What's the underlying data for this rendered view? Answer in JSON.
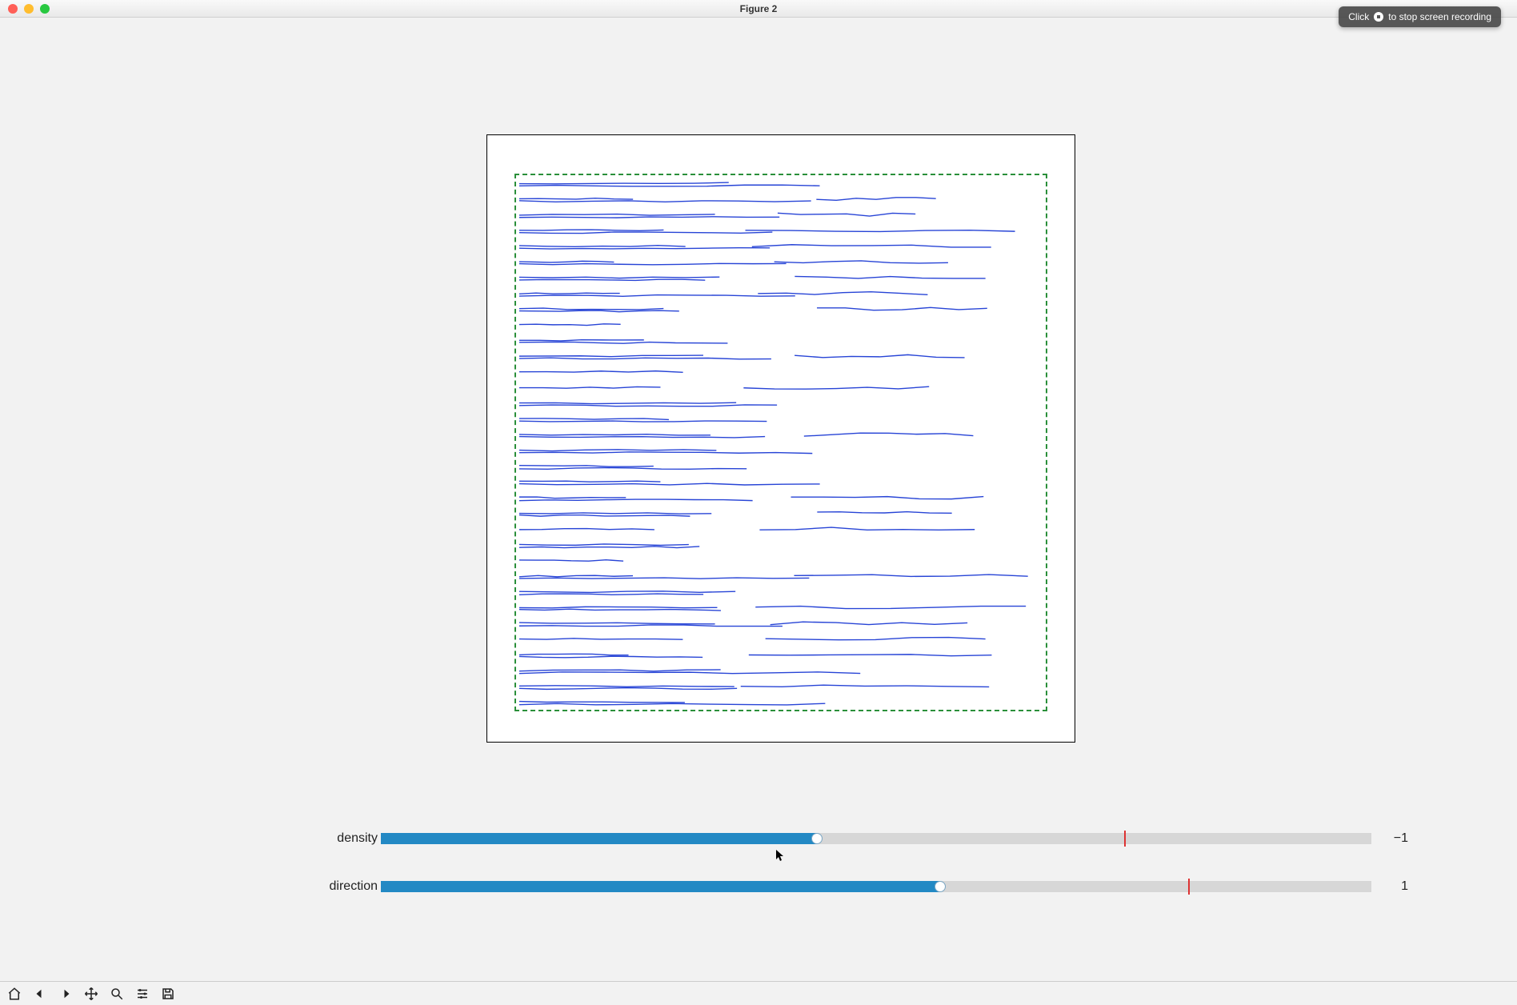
{
  "window": {
    "title": "Figure 2"
  },
  "screen_recording_tip": {
    "prefix": "Click",
    "suffix": "to stop screen recording"
  },
  "sliders": {
    "density": {
      "label": "density",
      "value": -1,
      "value_display": "−1",
      "min": -5,
      "max": 4,
      "mark": 2,
      "fill_pct": 44,
      "mark_pct": 75
    },
    "direction": {
      "label": "direction",
      "value": 1,
      "value_display": "1",
      "min": -5,
      "max": 4,
      "mark": 2,
      "fill_pct": 56.5,
      "mark_pct": 81.5
    }
  },
  "toolbar": {
    "home": "home-icon",
    "back": "left-arrow-icon",
    "fwd": "right-arrow-icon",
    "pan": "move-icon",
    "zoom": "zoom-icon",
    "config": "sliders-icon",
    "save": "save-icon"
  },
  "chart_data": {
    "type": "streamplot",
    "description": "Horizontal streamline field inside a dashed-green bounding box. Streamlines run left-to-right with near-zero vertical component; coverage is denser on the left half and becomes sparser toward the right. No axis ticks or numeric labels are shown.",
    "bounding_box_style": "dashed green",
    "stream_color": "#2744d6",
    "bands": 34,
    "left_coverage": 1.0,
    "right_coverage": 0.55,
    "parameters": {
      "density": -1,
      "direction": 1
    },
    "xlim": [
      0,
      1
    ],
    "ylim": [
      0,
      1
    ]
  }
}
